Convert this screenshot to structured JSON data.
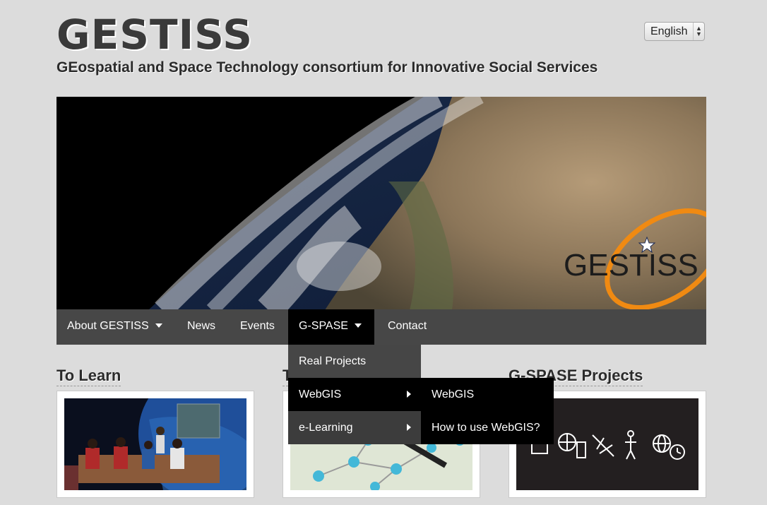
{
  "header": {
    "site_title": "GESTISS",
    "tagline": "GEospatial and Space Technology consortium for Innovative Social Services",
    "language_selected": "English"
  },
  "hero": {
    "logo_text": "GESTISS",
    "logo_colors": {
      "orbit": "#f08a12",
      "text": "#1c1c1c"
    }
  },
  "nav": {
    "items": [
      {
        "label": "About GESTISS",
        "has_dropdown": true
      },
      {
        "label": "News"
      },
      {
        "label": "Events"
      },
      {
        "label": "G-SPASE",
        "has_dropdown": true,
        "active": true
      },
      {
        "label": "Contact"
      }
    ]
  },
  "dropdown": {
    "items": [
      {
        "label": "Real Projects"
      },
      {
        "label": "WebGIS",
        "has_submenu": true
      },
      {
        "label": "e-Learning",
        "has_submenu": true
      }
    ]
  },
  "submenu": {
    "items": [
      {
        "label": "WebGIS"
      },
      {
        "label": "How to use WebGIS?"
      }
    ]
  },
  "sections": [
    {
      "title": "To Learn"
    },
    {
      "title": "T"
    },
    {
      "title": "G-SPASE Projects"
    }
  ],
  "colors": {
    "background": "#dcdcdc",
    "navbar": "#474747",
    "active": "#000000"
  }
}
